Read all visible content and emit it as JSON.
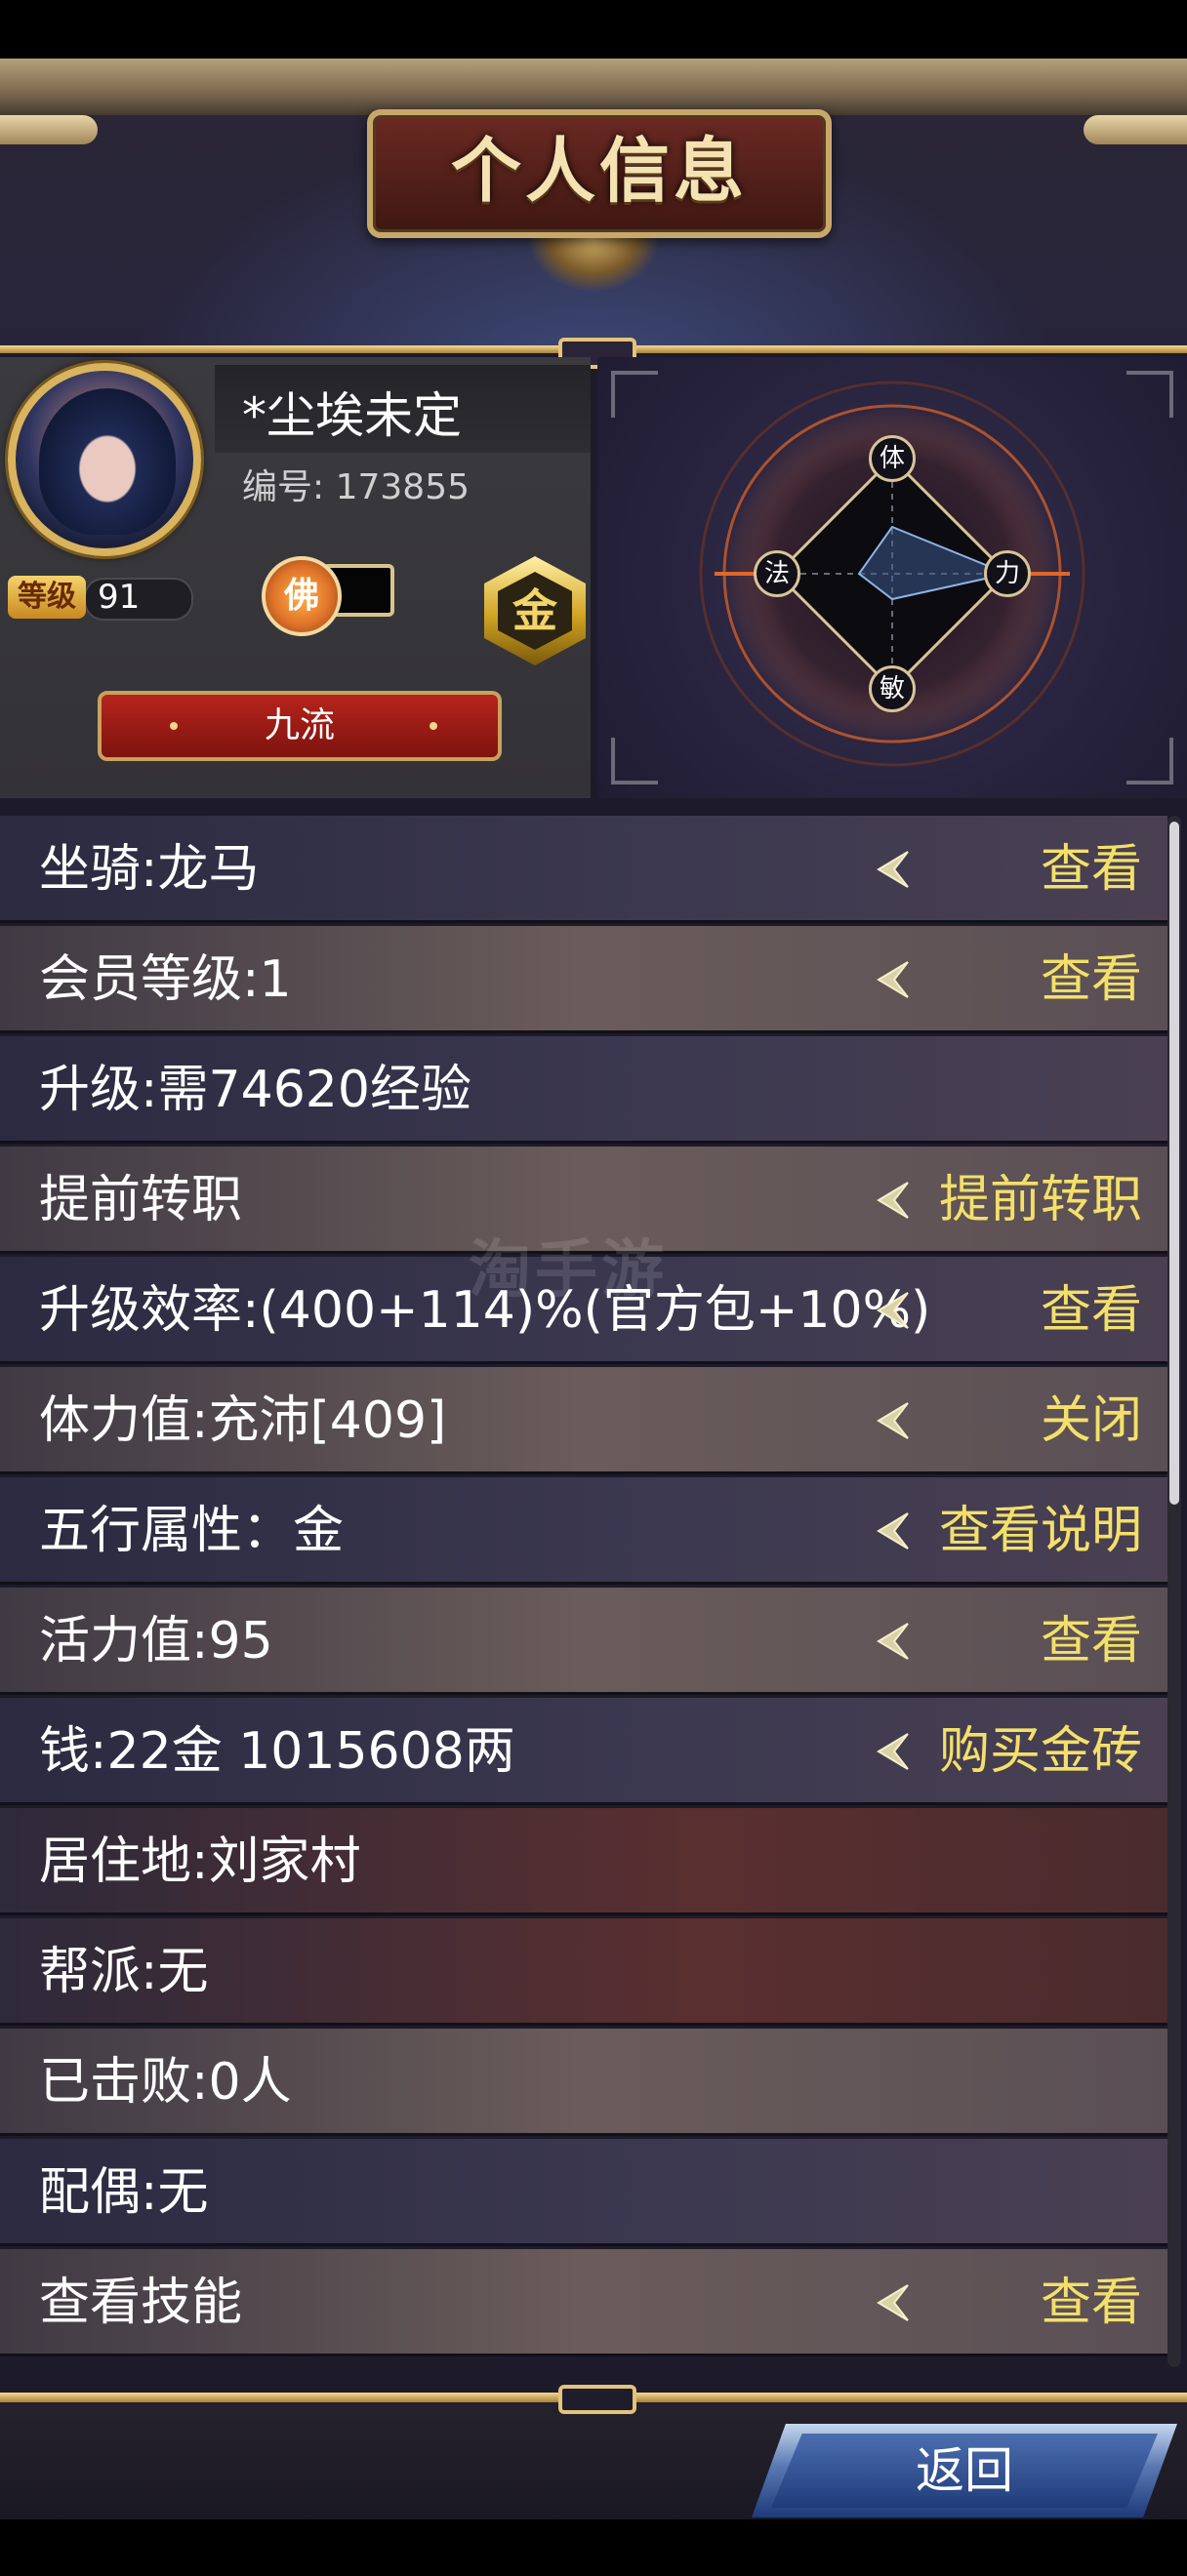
{
  "header": {
    "title": "个人信息"
  },
  "profile": {
    "name": "*尘埃未定",
    "id_label": "编号: 173855",
    "level_label": "等级",
    "level": "91",
    "buddha_char": "佛",
    "element_char": "金",
    "rank": "九流"
  },
  "radar": {
    "axes": [
      "体",
      "力",
      "敏",
      "法"
    ]
  },
  "rows": [
    {
      "label": "坐骑:龙马",
      "action": "查看"
    },
    {
      "label": "会员等级:1",
      "action": "查看"
    },
    {
      "label": "升级:需74620经验",
      "action": ""
    },
    {
      "label": "提前转职",
      "action": "提前转职"
    },
    {
      "label": "升级效率:(400+114)%(官方包+10%)",
      "action": "查看"
    },
    {
      "label": "体力值:充沛[409]",
      "action": "关闭"
    },
    {
      "label": "五行属性：金",
      "action": "查看说明"
    },
    {
      "label": "活力值:95",
      "action": "查看"
    },
    {
      "label": "钱:22金 1015608两",
      "action": "购买金砖"
    },
    {
      "label": "居住地:刘家村",
      "action": ""
    },
    {
      "label": "帮派:无",
      "action": ""
    },
    {
      "label": "已击败:0人",
      "action": ""
    },
    {
      "label": "配偶:无",
      "action": ""
    },
    {
      "label": "查看技能",
      "action": "查看"
    }
  ],
  "footer": {
    "back_label": "返回"
  },
  "watermark": "淘手游",
  "colors": {
    "action_text": "#f3e06a",
    "gold": "#d9b35d",
    "rank_red": "#b6241c"
  }
}
